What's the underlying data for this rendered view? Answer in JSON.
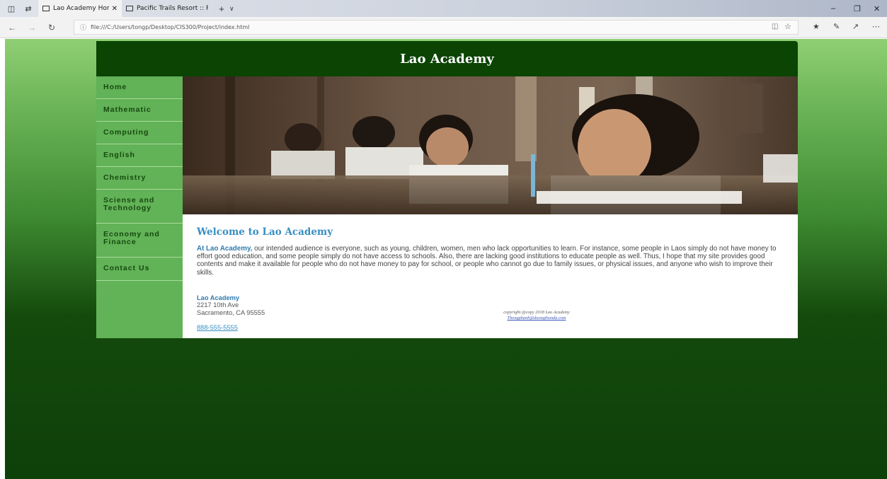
{
  "browser": {
    "tabs": [
      {
        "title": "Lao Academy Home Paд",
        "close": "✕"
      },
      {
        "title": "Pacific Trails Resort :: Reserv"
      }
    ],
    "new_tab": "+",
    "tab_menu": "∨",
    "url": "file:///C:/Users/tongp/Desktop/CIS300/Project/index.html",
    "window_controls": {
      "minimize": "–",
      "restore": "❐",
      "close": "✕"
    }
  },
  "site": {
    "title": "Lao Academy",
    "nav": [
      {
        "label": "Home"
      },
      {
        "label": "Mathematic"
      },
      {
        "label": "Computing"
      },
      {
        "label": "English"
      },
      {
        "label": "Chemistry"
      },
      {
        "label": "Sciense and Technology"
      },
      {
        "label": "Economy and Finance"
      },
      {
        "label": "Contact Us"
      }
    ],
    "welcome": "Welcome to Lao Academy",
    "intro_lead": "At Lao Academy,",
    "intro_text": " our intended audience is everyone, such as young, children, women, men who lack opportunities to learn. For instance, some people in Laos simply do not have money to effort good education, and some people simply do not have access to schools. Also, there are lacking good institutions to educate people as well. Thus, I hope that my site provides good contents and make it available for people who do not have money to pay for school, or people who cannot go due to family issues, or physical issues, and anyone who wish to improve their skills.",
    "address": {
      "name": "Lao Academy",
      "street": "2217 10th Ave",
      "city": "Sacramento, CA 95555",
      "phone": "888-555-5555"
    },
    "copyright": "copyright @copy 2018 Lao Academy",
    "email": "Thongphanh@duongthonda.com"
  },
  "colors": {
    "header_bg": "#0b4403",
    "nav_bg": "#62b257",
    "nav_text": "#164a10",
    "accent_blue": "#3a8fc2"
  },
  "icons": [
    "tab-list-icon",
    "set-aside-tabs-icon",
    "page-icon",
    "back-icon",
    "forward-icon",
    "refresh-icon",
    "info-icon",
    "reading-view-icon",
    "favorite-star-icon",
    "favorites-icon",
    "pen-icon",
    "share-icon",
    "more-icon"
  ]
}
